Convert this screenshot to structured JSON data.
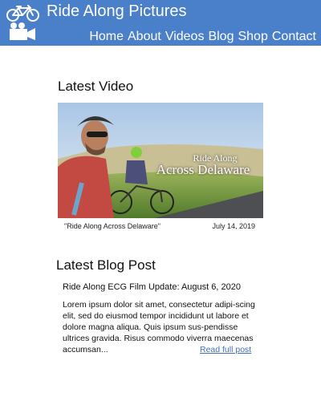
{
  "colors": {
    "header_background": "#4a7fca",
    "header_text": "#ffffff",
    "link": "#3f6fbd"
  },
  "header": {
    "logo_icon": "bicycle-movie-camera-icon",
    "title": "Ride Along Pictures",
    "nav": [
      "Home",
      "About",
      "Videos",
      "Blog",
      "Shop",
      "Contact"
    ]
  },
  "latest_video": {
    "heading": "Latest Video",
    "thumbnail_text_line1": "Ride Along",
    "thumbnail_text_line2": "Across Delaware",
    "caption": "\"Ride Along Across Delaware\"",
    "date": "July 14, 2019"
  },
  "latest_blog_post": {
    "heading": "Latest Blog Post",
    "title": "Ride Along ECG Film Update: August 6, 2020",
    "excerpt": "Lorem ipsum dolor sit amet, consectetur adipi-scing elit, sed do eiusmod tempor incididunt ut labore et dolore magna aliqua. Quis ipsum sus-pendisse ultrices gravida. Risus commodo viverra maecenas accumsan...",
    "read_more_label": "Read full post"
  }
}
